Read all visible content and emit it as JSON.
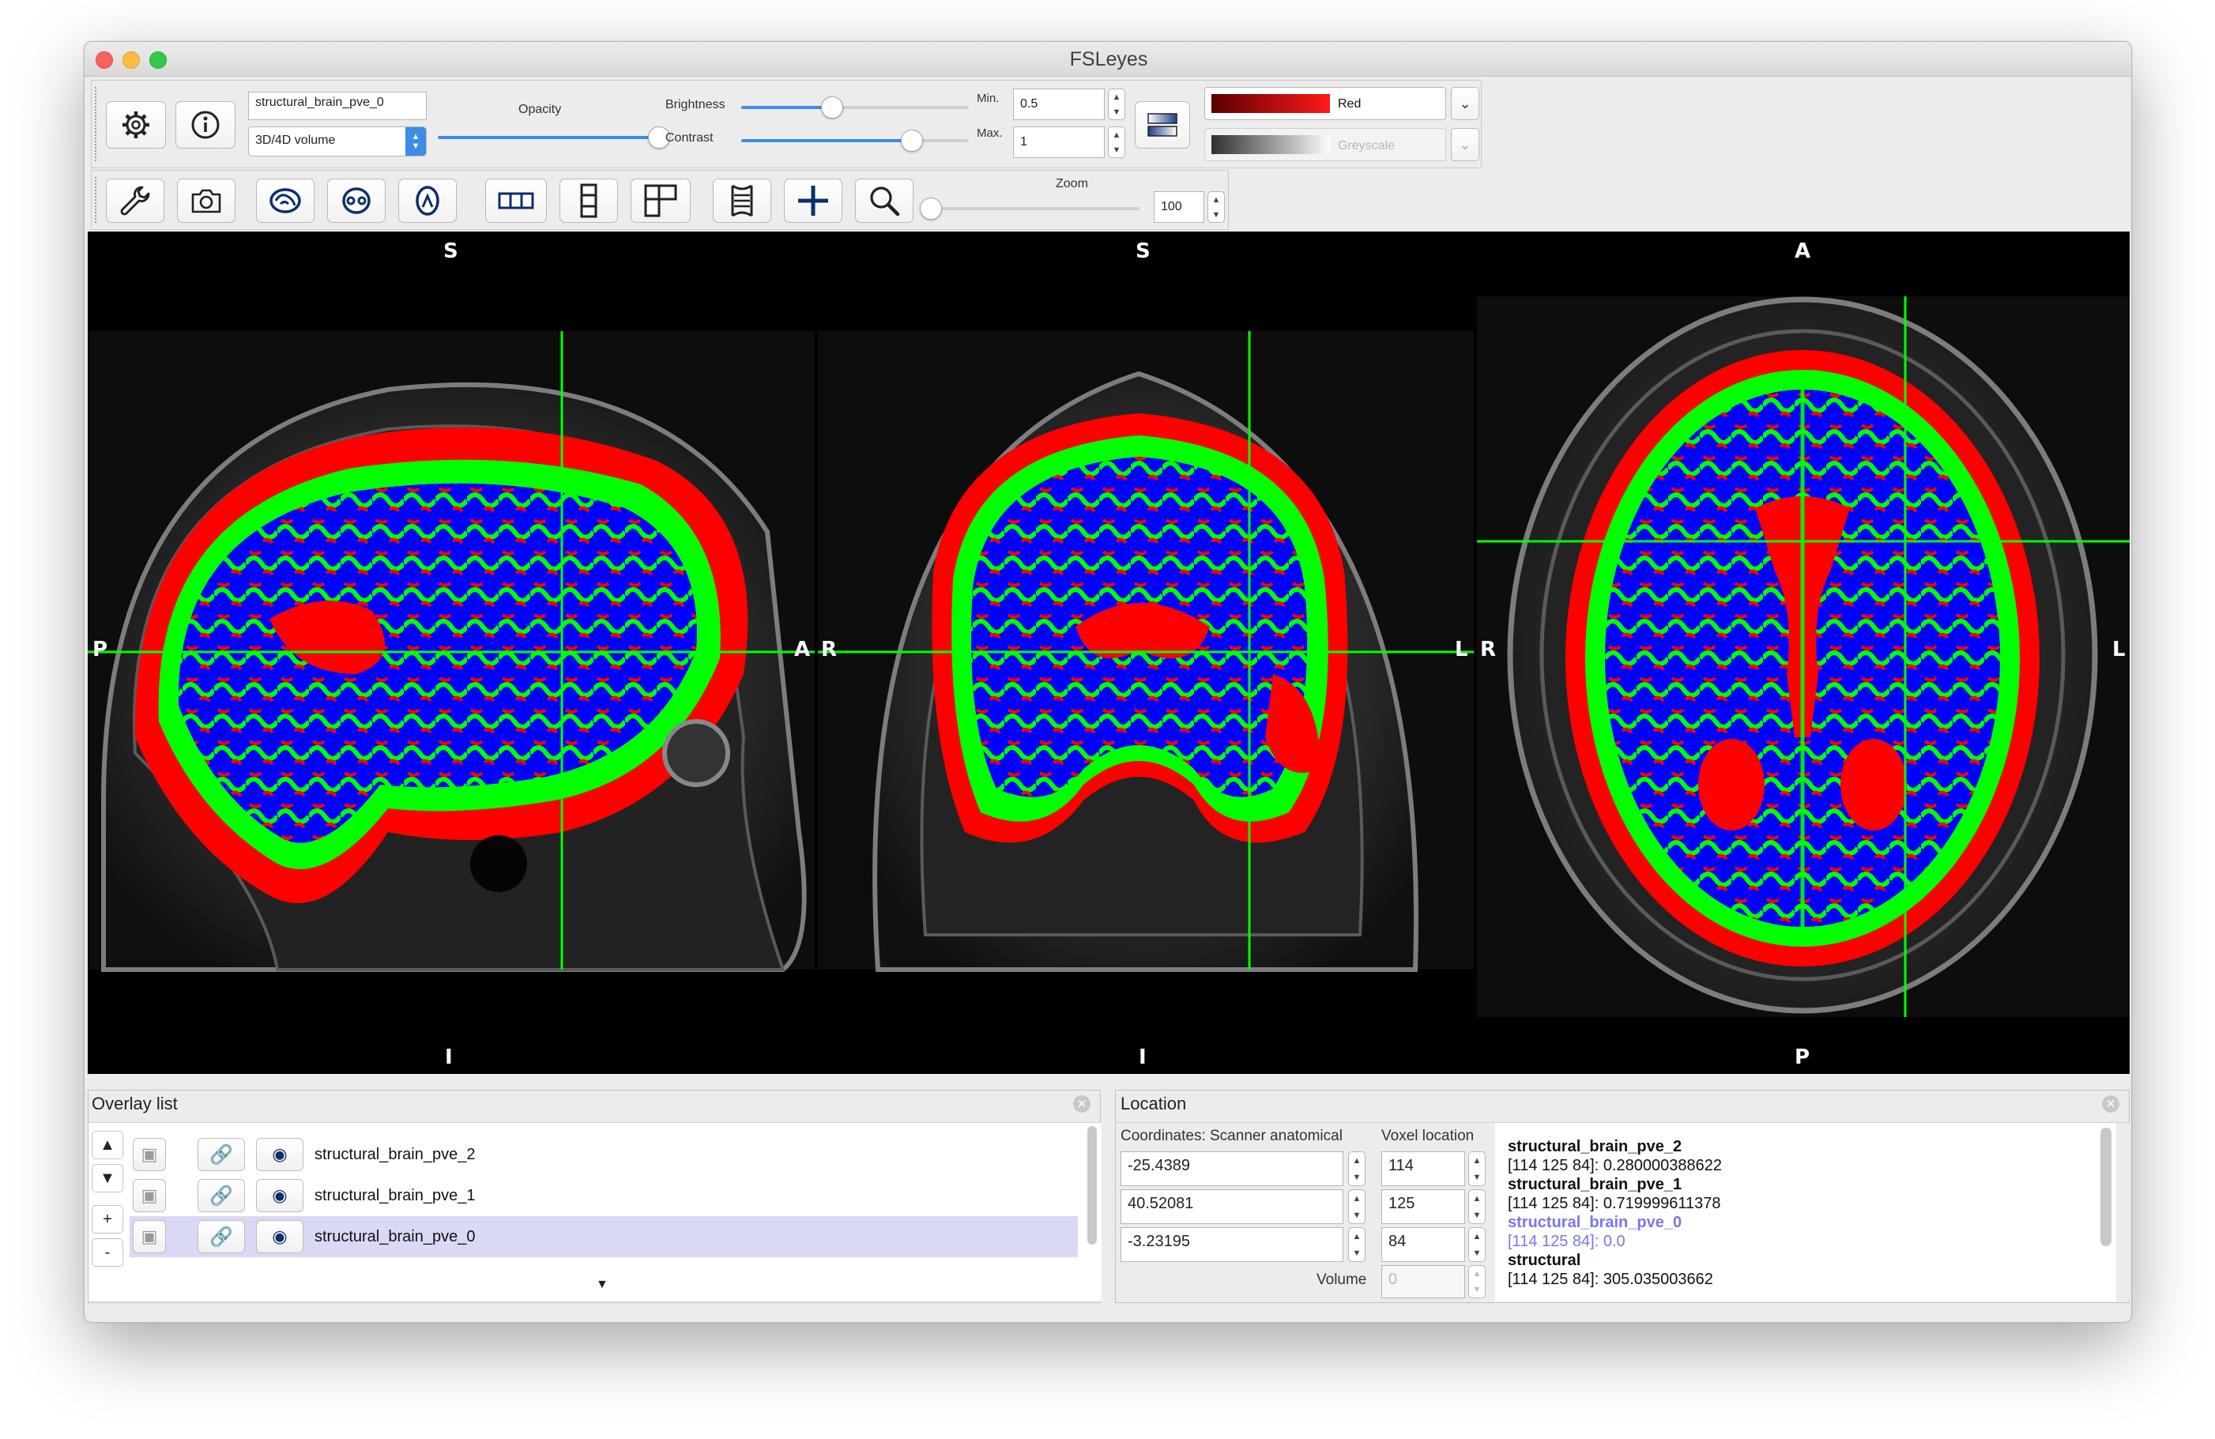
{
  "window": {
    "title": "FSLeyes"
  },
  "overlay_toolbar": {
    "overlay_name": "structural_brain_pve_0",
    "overlay_type": "3D/4D volume",
    "opacity_label": "Opacity",
    "opacity_level": 1.0,
    "brightness_label": "Brightness",
    "brightness_level": 0.4,
    "contrast_label": "Contrast",
    "contrast_level": 0.75,
    "min_label": "Min.",
    "min_value": "0.5",
    "max_label": "Max.",
    "max_value": "1",
    "cmap_primary": "Red",
    "cmap_secondary": "Greyscale",
    "colors": {
      "red_cmap_dark": "#5a0000",
      "red_cmap_bright": "#ff1a1a"
    }
  },
  "view_toolbar": {
    "zoom_label": "Zoom",
    "zoom_value": "100",
    "icons": [
      "wrench-icon",
      "camera-icon",
      "sagittal-icon",
      "coronal-icon",
      "axial-icon",
      "horizontal-layout-icon",
      "vertical-layout-icon",
      "grid-layout-icon",
      "movie-icon",
      "crosshair-icon",
      "zoom-icon"
    ]
  },
  "views": {
    "sagittal": {
      "top": "S",
      "bottom": "I",
      "left": "P",
      "right": "A"
    },
    "coronal": {
      "top": "S",
      "bottom": "I",
      "left": "R",
      "right": "L"
    },
    "axial": {
      "top": "A",
      "bottom": "P",
      "left": "R",
      "right": "L"
    },
    "colors": {
      "gm": "#ff0000",
      "wm": "#0000ff",
      "csf": "#00ff00",
      "cursor": "#00ff00"
    }
  },
  "overlay_list": {
    "title": "Overlay list",
    "items": [
      {
        "name": "structural_brain_pve_2",
        "selected": false
      },
      {
        "name": "structural_brain_pve_1",
        "selected": false
      },
      {
        "name": "structural_brain_pve_0",
        "selected": true
      }
    ],
    "side_buttons": [
      "▲",
      "▼",
      "+",
      "-"
    ],
    "colors": {
      "selected_row": "#d9d9f6"
    }
  },
  "location": {
    "title": "Location",
    "coords_label": "Coordinates: Scanner anatomical",
    "voxel_label": "Voxel location",
    "coords": [
      "-25.4389",
      "40.52081",
      "-3.23195"
    ],
    "voxels": [
      "114",
      "125",
      "84"
    ],
    "volume_label": "Volume",
    "volume_value": "0",
    "info": [
      {
        "name": "structural_brain_pve_2",
        "value": "[114 125 84]: 0.280000388622",
        "highlight": false
      },
      {
        "name": "structural_brain_pve_1",
        "value": "[114 125 84]: 0.719999611378",
        "highlight": false
      },
      {
        "name": "structural_brain_pve_0",
        "value": "[114 125 84]: 0.0",
        "highlight": true
      },
      {
        "name": "structural",
        "value": "[114 125 84]: 305.035003662",
        "highlight": false
      }
    ],
    "colors": {
      "highlight_text": "#7777ee"
    }
  }
}
